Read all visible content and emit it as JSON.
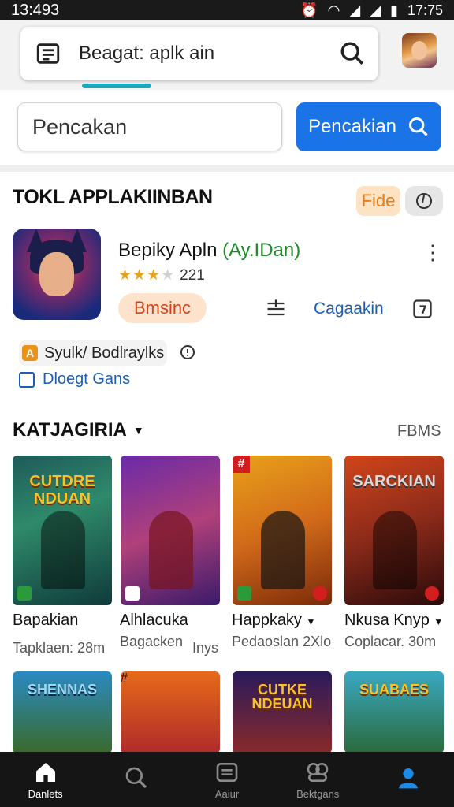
{
  "status_bar": {
    "time_left": "13:493",
    "time_right": "17:75"
  },
  "header": {
    "search_text": "Beagat: aplk ain"
  },
  "search": {
    "input_placeholder": "Pencakan",
    "button_label": "Pencakian"
  },
  "section": {
    "title": "TOKL APPLAKIINBAN",
    "pill_label": "Fide"
  },
  "featured_app": {
    "name": "Bepiky Apln",
    "name_suffix": "(Ay.IDan)",
    "rating_count": "221",
    "badge": "Bmsinc",
    "link": "Cagaakin",
    "tag1": "Syulk/ Bodlraylks",
    "tag2": "Dloegt Gans"
  },
  "categories": {
    "title": "KATJAGIRIA",
    "more_label": "FBMS",
    "cards": [
      {
        "art_title": "CUTDRE NDUAN",
        "name": "Bapakian",
        "meta": "Tapklaen: 28m"
      },
      {
        "art_title": "",
        "name": "Alhlacuka",
        "meta": "Bagacken",
        "meta2": "Inys"
      },
      {
        "art_title": "",
        "name": "Happkaky",
        "meta": "Pedaoslan 2Xlo"
      },
      {
        "art_title": "SARCKIAN",
        "name": "Nkusa Knyp",
        "meta": "Coplacar. 30m"
      }
    ],
    "cards_row2": [
      {
        "art_title": "SHENNAS"
      },
      {
        "art_title": ""
      },
      {
        "art_title": "CUTKE NDEUAN"
      },
      {
        "art_title": "SUABAES"
      }
    ]
  },
  "nav": {
    "items": [
      "Danlets",
      "",
      "Aaiur",
      "Bektgans",
      ""
    ]
  },
  "colors": {
    "accent": "#1b73e8",
    "teal": "#1aa9b9",
    "navbar": "#151515",
    "badge_bg": "#fde3cc"
  }
}
